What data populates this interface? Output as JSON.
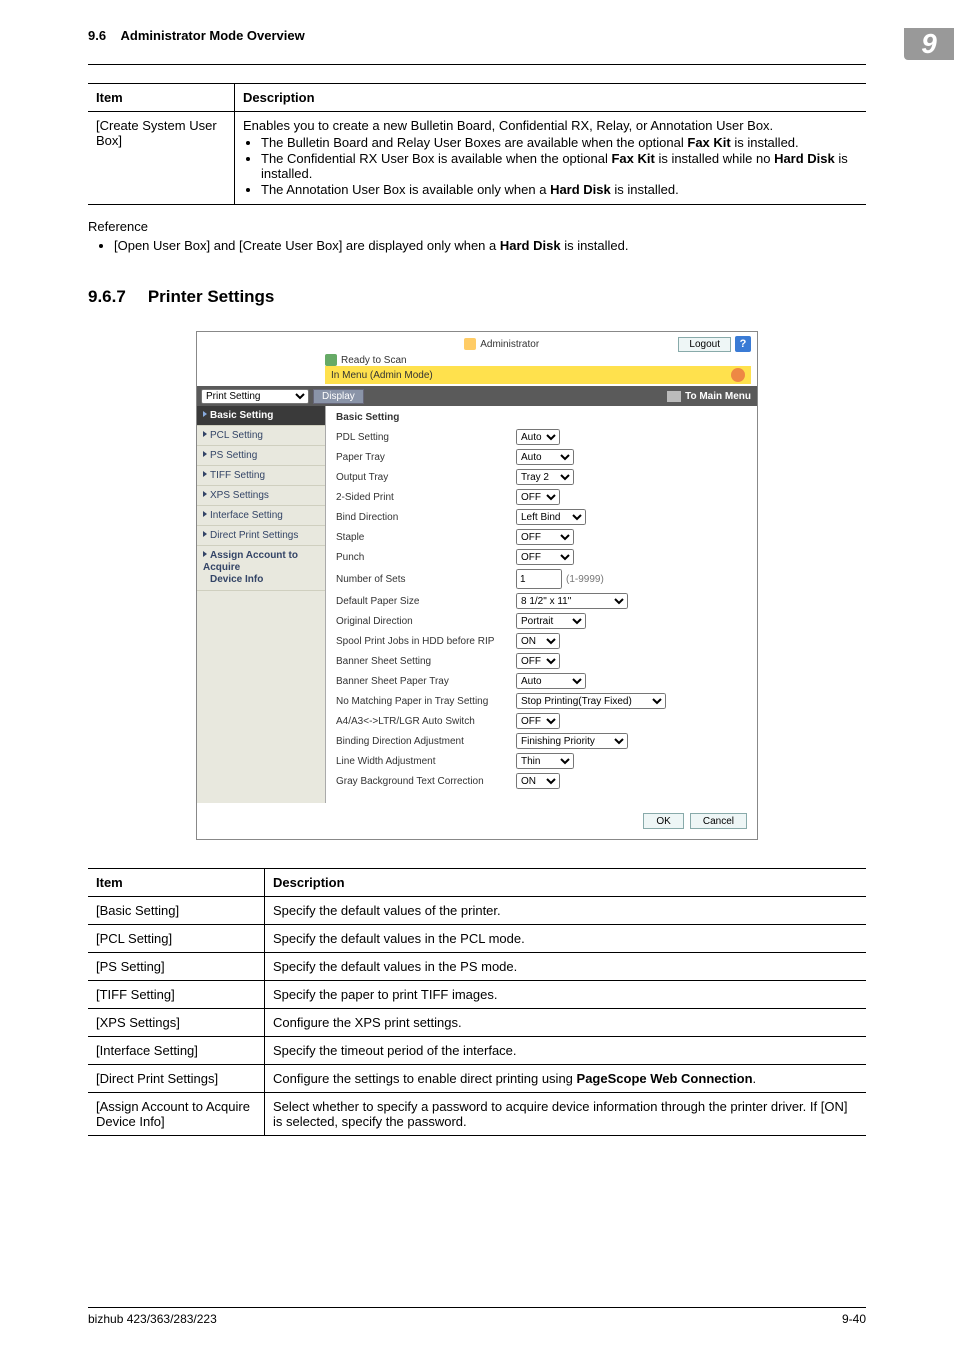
{
  "header": {
    "section_no": "9.6",
    "title": "Administrator Mode Overview",
    "badge": "9"
  },
  "table1": {
    "head_item": "Item",
    "head_desc": "Description",
    "row_item": "[Create System User Box]",
    "row_desc_lead": "Enables you to create a new Bulletin Board, Confidential RX, Relay, or Annotation User Box.",
    "bullets": {
      "b1_a": "The Bulletin Board and Relay User Boxes are available when the optional ",
      "b1_bold": "Fax Kit",
      "b1_c": " is installed.",
      "b2_a": "The Confidential RX User Box is available when the optional ",
      "b2_bold1": "Fax Kit",
      "b2_b": " is installed while no ",
      "b2_bold2": "Hard Disk",
      "b2_c": " is installed.",
      "b3_a": "The Annotation User Box is available only when a ",
      "b3_bold": "Hard Disk",
      "b3_b": " is installed."
    }
  },
  "reference": {
    "label": "Reference",
    "line_a": "[Open User Box] and [Create User Box] are displayed only when a ",
    "line_bold": "Hard Disk",
    "line_b": " is installed."
  },
  "section": {
    "num": "9.6.7",
    "title": "Printer Settings"
  },
  "shot": {
    "admin_label": "Administrator",
    "logout": "Logout",
    "help_q": "?",
    "ready": "Ready to Scan",
    "ybar_text": "In Menu (Admin Mode)",
    "print_setting_label": "Print Setting",
    "display_btn": "Display",
    "to_main_menu": "To Main Menu",
    "nav": {
      "basic": "Basic Setting",
      "pcl": "PCL Setting",
      "ps": "PS Setting",
      "tiff": "TIFF Setting",
      "xps": "XPS Settings",
      "iface": "Interface Setting",
      "direct": "Direct Print Settings",
      "assign_l1": "Assign Account to Acquire",
      "assign_l2": "Device Info"
    },
    "pane_title": "Basic Setting",
    "rows": {
      "pdl": {
        "label": "PDL Setting",
        "value": "Auto"
      },
      "ptray": {
        "label": "Paper Tray",
        "value": "Auto"
      },
      "otray": {
        "label": "Output Tray",
        "value": "Tray 2"
      },
      "twosided": {
        "label": "2-Sided Print",
        "value": "OFF"
      },
      "binddir": {
        "label": "Bind Direction",
        "value": "Left Bind"
      },
      "staple": {
        "label": "Staple",
        "value": "OFF"
      },
      "punch": {
        "label": "Punch",
        "value": "OFF"
      },
      "nsets": {
        "label": "Number of Sets",
        "value": "1",
        "note": "(1-9999)"
      },
      "defpaper": {
        "label": "Default Paper Size",
        "value": "8 1/2\" x 11\""
      },
      "origdir": {
        "label": "Original Direction",
        "value": "Portrait"
      },
      "spool": {
        "label": "Spool Print Jobs in HDD before RIP",
        "value": "ON"
      },
      "banner": {
        "label": "Banner Sheet Setting",
        "value": "OFF"
      },
      "bannertray": {
        "label": "Banner Sheet Paper Tray",
        "value": "Auto"
      },
      "nomatch": {
        "label": "No Matching Paper in Tray Setting",
        "value": "Stop Printing(Tray Fixed)"
      },
      "a4a3": {
        "label": "A4/A3<->LTR/LGR Auto Switch",
        "value": "OFF"
      },
      "bindadj": {
        "label": "Binding Direction Adjustment",
        "value": "Finishing Priority"
      },
      "linew": {
        "label": "Line Width Adjustment",
        "value": "Thin"
      },
      "gray": {
        "label": "Gray Background Text Correction",
        "value": "ON"
      }
    },
    "ok": "OK",
    "cancel": "Cancel"
  },
  "table2": {
    "head_item": "Item",
    "head_desc": "Description",
    "rows": [
      {
        "item": "[Basic Setting]",
        "desc": "Specify the default values of the printer."
      },
      {
        "item": "[PCL Setting]",
        "desc": "Specify the default values in the PCL mode."
      },
      {
        "item": "[PS Setting]",
        "desc": "Specify the default values in the PS mode."
      },
      {
        "item": "[TIFF Setting]",
        "desc": "Specify the paper to print TIFF images."
      },
      {
        "item": "[XPS Settings]",
        "desc": "Configure the XPS print settings."
      },
      {
        "item": "[Interface Setting]",
        "desc": "Specify the timeout period of the interface."
      }
    ],
    "direct": {
      "item": "[Direct Print Settings]",
      "a": "Configure the settings to enable direct printing using ",
      "bold": "PageScope Web Connection",
      "b": "."
    },
    "assign": {
      "item": "[Assign Account to Acquire Device Info]",
      "desc": "Select whether to specify a password to acquire device information through the printer driver. If [ON] is selected, specify the password."
    }
  },
  "footer": {
    "left": "bizhub 423/363/283/223",
    "right": "9-40"
  }
}
